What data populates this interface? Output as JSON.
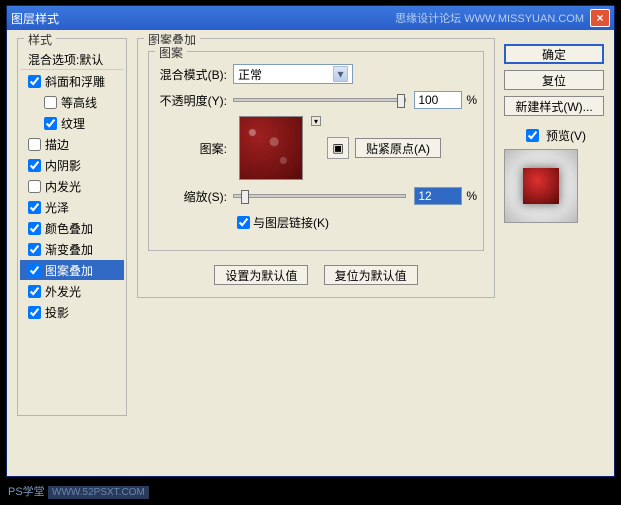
{
  "titlebar": {
    "title": "图层样式",
    "watermark": "思缘设计论坛  WWW.MISSYUAN.COM",
    "close": "×"
  },
  "styles": {
    "heading": "样式",
    "blendopts": "混合选项:默认",
    "items": [
      {
        "label": "斜面和浮雕",
        "checked": true
      },
      {
        "label": "等高线",
        "checked": false,
        "indent": true
      },
      {
        "label": "纹理",
        "checked": true,
        "indent": true
      },
      {
        "label": "描边",
        "checked": false
      },
      {
        "label": "内阴影",
        "checked": true
      },
      {
        "label": "内发光",
        "checked": false
      },
      {
        "label": "光泽",
        "checked": true
      },
      {
        "label": "颜色叠加",
        "checked": true
      },
      {
        "label": "渐变叠加",
        "checked": true
      },
      {
        "label": "图案叠加",
        "checked": true,
        "selected": true
      },
      {
        "label": "外发光",
        "checked": true
      },
      {
        "label": "投影",
        "checked": true
      }
    ]
  },
  "patternOverlay": {
    "heading": "图案叠加",
    "pattern_group": "图案",
    "blend_label": "混合模式(B):",
    "blend_value": "正常",
    "opacity_label": "不透明度(Y):",
    "opacity_value": "100",
    "opacity_unit": "%",
    "pattern_label": "图案:",
    "snap_button": "贴紧原点(A)",
    "scale_label": "缩放(S):",
    "scale_value": "12",
    "scale_unit": "%",
    "link_label": "与图层链接(K)",
    "link_checked": true,
    "set_default": "设置为默认值",
    "reset_default": "复位为默认值"
  },
  "right": {
    "ok": "确定",
    "reset": "复位",
    "newstyle": "新建样式(W)...",
    "preview_label": "预览(V)",
    "preview_checked": true
  },
  "footer": {
    "wm1": "PS学堂",
    "wm2": "WWW.52PSXT.COM"
  }
}
